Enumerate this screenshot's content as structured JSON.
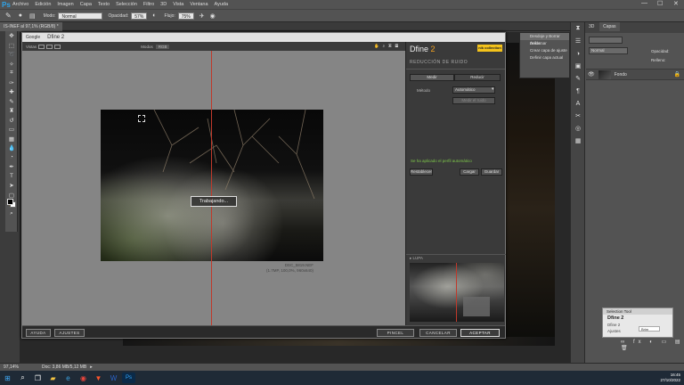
{
  "app": {
    "logo": "Ps"
  },
  "menu": [
    "Archivo",
    "Edición",
    "Imagen",
    "Capa",
    "Texto",
    "Selección",
    "Filtro",
    "3D",
    "Vista",
    "Ventana",
    "Ayuda"
  ],
  "window_controls": {
    "minimize": "—",
    "maximize": "☐",
    "close": "✕"
  },
  "options": {
    "mode_label": "Modo:",
    "mode_value": "Normal",
    "opacity_label": "Opacidad:",
    "opacity_value": "57%",
    "flow_label": "Flujo:",
    "flow_value": "75%"
  },
  "document_tab": "IS-INEF al 97,1% (RGB/8) *",
  "statusbar": {
    "zoom": "97,14%",
    "doc": "Doc: 3,86 MB/5,12 MB"
  },
  "history_panel": {
    "items": [
      "Desdoje y Borrar Ácido...",
      "Deformar",
      "Crear capa de ajuste",
      "Definir capa actual"
    ]
  },
  "layers_panel": {
    "tabs": [
      "3D",
      "Capas"
    ],
    "layer_name": "Fondo",
    "blend": "Normal",
    "opacity_label": "Opacidad:",
    "fill_label": "Relleno:"
  },
  "properties_panel": {
    "header": "Selection Tool",
    "title": "Dfine 2",
    "row1": "Dfine 2",
    "row2": "Ajustes",
    "value": "Brim"
  },
  "dialog": {
    "title_app": "Google",
    "title_plugin": "Dfine 2",
    "viewbar": {
      "views_label": "Vistas",
      "mode_label": "Modos",
      "mode_value": "RGB"
    },
    "logo_main": "Dfine",
    "logo_version": "2",
    "nik_badge": "nik collection",
    "section": "REDUCCIÓN DE RUIDO",
    "btn_medir": "Medir",
    "btn_reducir": "Reducir",
    "method_label": "Método",
    "method_value": "Automático",
    "btn_add": "Medir el ruido",
    "status_msg": "Se ha aplicado el perfil automático",
    "btn_restablecer": "Restablecer",
    "btn_cargar": "Cargar",
    "btn_guardar": "Guardar",
    "lupa": "▸ LUPA",
    "working": "Trabajando...",
    "caption_line1": "DSC_5819.NEF",
    "caption_line2": "(1.7MP, 100,0%, 960x640)",
    "footer": {
      "ayuda": "AYUDA",
      "ajustes": "AJUSTES",
      "pincel": "PINCEL",
      "cancelar": "CANCELAR",
      "aceptar": "ACEPTAR"
    }
  },
  "taskbar": {
    "time": "16:45",
    "date": "27/10/2022"
  },
  "colors": {
    "accent": "#2fa3e8",
    "dfine_orange": "#f0a020",
    "split_line": "#c0392b",
    "status_green": "#7ec84a"
  }
}
